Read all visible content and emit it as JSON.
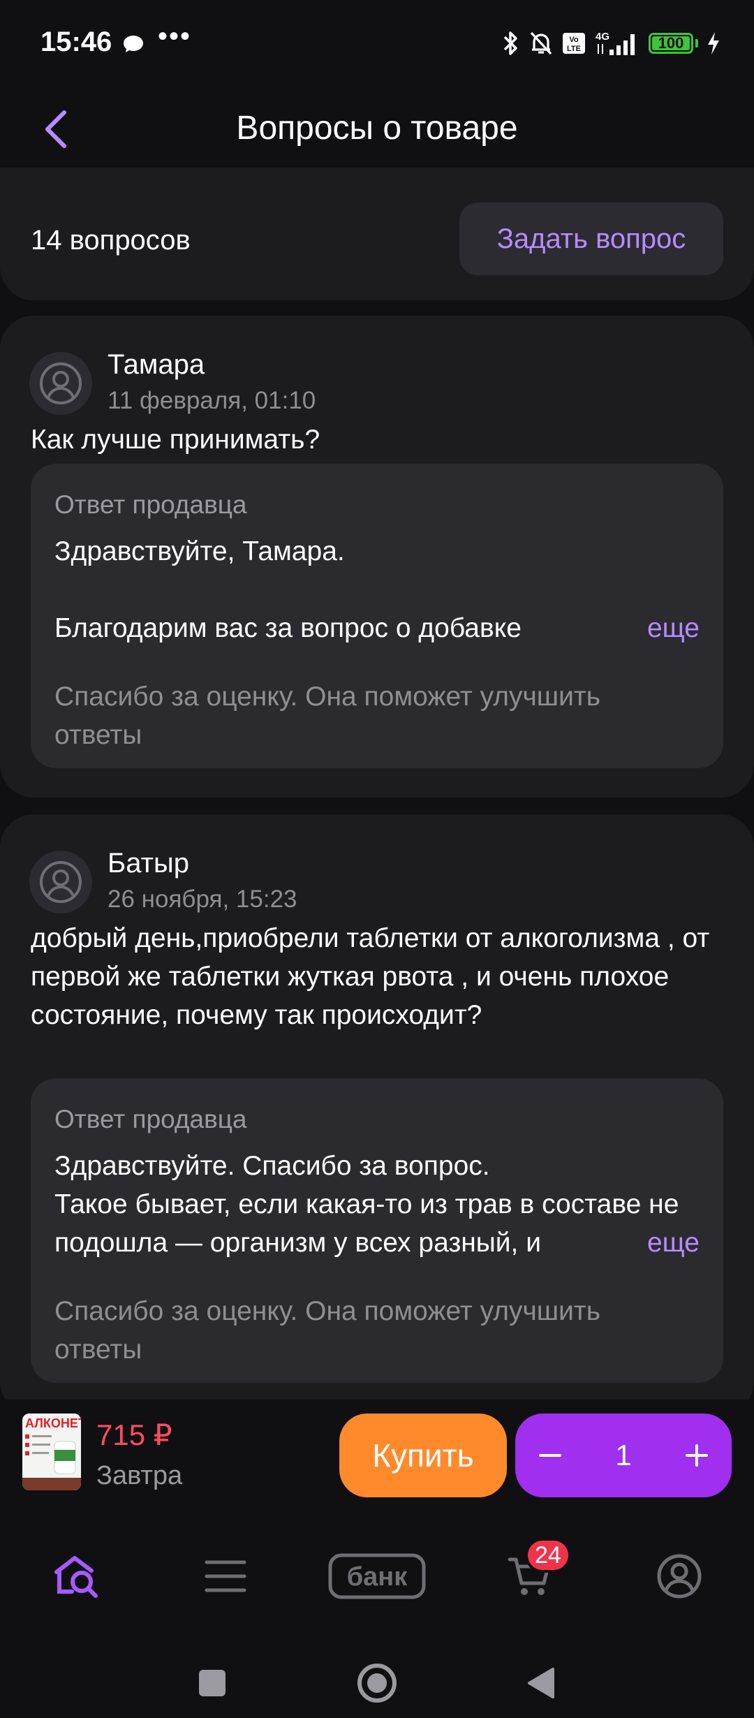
{
  "status_bar": {
    "time": "15:46",
    "dots": "•••",
    "icons": [
      "chat-icon",
      "bluetooth-icon",
      "mute-icon",
      "volte-icon",
      "4g-signal-icon",
      "battery-icon",
      "charging-icon"
    ],
    "battery": "100"
  },
  "header": {
    "title": "Вопросы о товаре",
    "back_icon": "chevron-left-icon"
  },
  "summary": {
    "count": "14 вопросов",
    "ask_button": "Задать вопрос"
  },
  "questions": [
    {
      "author": "Тамара",
      "date": "11 февраля, 01:10",
      "text": "Как лучше принимать?",
      "answer_label": "Ответ продавца",
      "answer_text": "Здравствуйте, Тамара.\n\nБлагодарим вас за вопрос о добавке",
      "more": "еще",
      "note": "Спасибо за оценку. Она поможет улучшить ответы"
    },
    {
      "author": "Батыр",
      "date": "26 ноября, 15:23",
      "text": "добрый день,приобрели таблетки от алкоголизма , от первой же таблетки жуткая рвота , и очень плохое состояние, почему так происходит?",
      "answer_label": "Ответ продавца",
      "answer_text": "Здравствуйте. Спасибо за вопрос.\nТакое бывает, если какая-то из трав в составе не подошла — организм у всех разный, и",
      "more": "еще",
      "note": "Спасибо за оценку. Она поможет улучшить ответы"
    }
  ],
  "buy_bar": {
    "product_brand": "АЛКОНЕТ",
    "price": "715 ₽",
    "delivery": "Завтра",
    "buy_button": "Купить",
    "quantity": "1"
  },
  "bottom_nav": {
    "items": [
      "home-search-icon",
      "catalog-icon",
      "bank-icon",
      "cart-icon",
      "profile-icon"
    ],
    "bank_label": "банк",
    "cart_badge": "24"
  },
  "colors": {
    "accent": "#b68cff",
    "buy": "#ff8a2b",
    "qty": "#a02ff0",
    "price": "#ff4d5e",
    "card": "#1c1c1f"
  }
}
